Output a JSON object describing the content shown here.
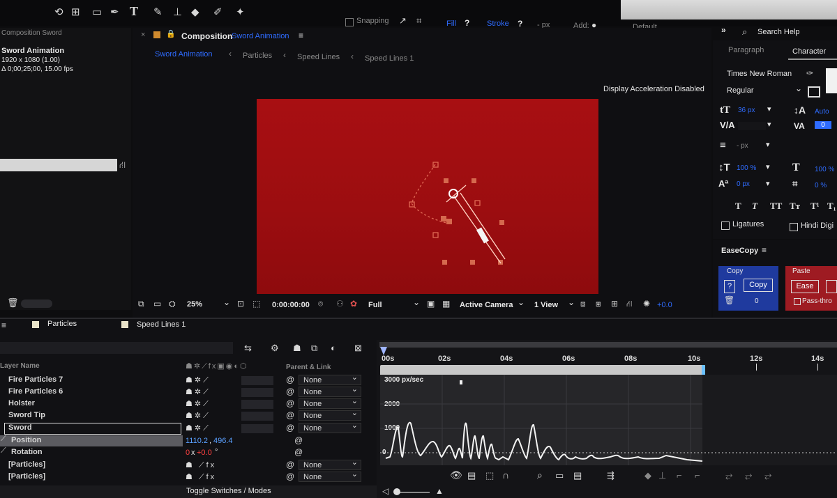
{
  "toolbar": {
    "snapping_label": "Snapping",
    "fill_label": "Fill",
    "stroke_label": "Stroke",
    "stroke_px": "- px",
    "add_label": "Add:",
    "default_label": "Default",
    "search_help": "Search Help"
  },
  "project": {
    "title": "Composition Sword",
    "comp_name": "Sword Animation",
    "comp_size": "1920 x 1080 (1.00)",
    "comp_duration": "Δ 0;00;25;00, 15.00 fps"
  },
  "composition_panel": {
    "tab_label": "Composition",
    "tab_name": "Sword Animation",
    "breadcrumbs": [
      "Sword Animation",
      "Particles",
      "Speed Lines",
      "Speed Lines 1"
    ],
    "notice": "Display Acceleration Disabled",
    "zoom": "25%",
    "timecode": "0:00:00:00",
    "resolution": "Full",
    "camera": "Active Camera",
    "views": "1 View",
    "exposure": "+0.0"
  },
  "character_panel": {
    "tab_paragraph": "Paragraph",
    "tab_character": "Character",
    "font": "Times New Roman",
    "style": "Regular",
    "font_size": "36 px",
    "leading": "Auto",
    "kerning": "",
    "tracking": "0",
    "stroke_width": "- px",
    "vertical_scale": "100 %",
    "horizontal_scale": "100 %",
    "baseline_shift": "0 px",
    "tsume": "0 %",
    "ligatures_label": "Ligatures",
    "hindi_label": "Hindi Digi"
  },
  "easecopy": {
    "title": "EaseCopy",
    "copy_header": "Copy",
    "copy_button": "Copy",
    "copy_help": "?",
    "copy_count": "0",
    "paste_header": "Paste",
    "ease_button": "Ease",
    "pass_label": "Pass-thro"
  },
  "timeline": {
    "tabs": [
      "Particles",
      "Speed Lines 1"
    ],
    "col_layer_name": "Layer Name",
    "col_parent": "Parent & Link",
    "layers": [
      {
        "name": "Fire Particles 7",
        "parent": "None"
      },
      {
        "name": "Fire Particles 6",
        "parent": "None"
      },
      {
        "name": "Holster",
        "parent": "None"
      },
      {
        "name": "Sword Tip",
        "parent": "None"
      },
      {
        "name": "Sword",
        "parent": "None"
      }
    ],
    "position_label": "Position",
    "position_value_x": "1110.2",
    "position_value_y": "496.4",
    "rotation_label": "Rotation",
    "rotation_value_rev": "0",
    "rotation_value_deg": "+0.0",
    "particles_layers": [
      {
        "name": "[Particles]",
        "parent": "None"
      },
      {
        "name": "[Particles]",
        "parent": "None"
      }
    ],
    "footer": "Toggle Switches / Modes",
    "ticks": [
      "00s",
      "02s",
      "04s",
      "06s",
      "08s",
      "10s",
      "12s",
      "14s"
    ],
    "graph_labels": [
      "3000 px/sec",
      "2000",
      "1000",
      "0"
    ]
  },
  "colors": {
    "comp_red": "#a30f12",
    "accent_blue": "#2f6cff",
    "copy_panel": "#1f3a9e",
    "paste_panel": "#9e1b22"
  }
}
